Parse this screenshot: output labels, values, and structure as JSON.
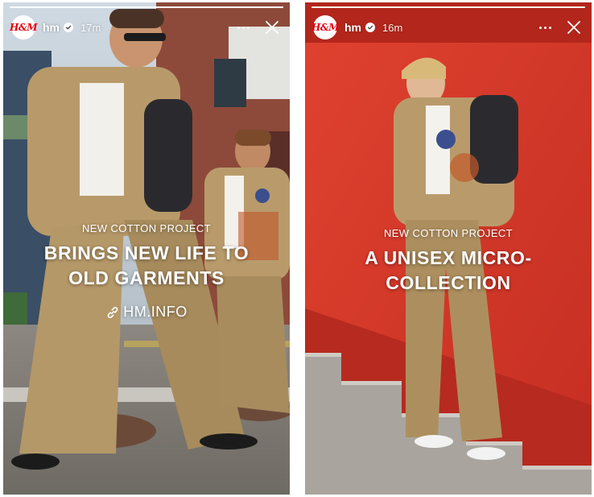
{
  "colors": {
    "brand_red": "#e50010",
    "wall_red": "#d9362a",
    "jacket_tan": "#b89a6a"
  },
  "stories": [
    {
      "account": {
        "username": "hm",
        "avatar_text": "H&M",
        "verified": true
      },
      "time": "17m",
      "progress": 1.0,
      "kicker": "NEW COTTON PROJECT",
      "headline": "BRINGS NEW LIFE TO OLD GARMENTS",
      "link": {
        "label": "HM.INFO",
        "icon": "link-icon"
      },
      "icons": {
        "more": "more-icon",
        "close": "close-icon",
        "verified": "verified-icon"
      }
    },
    {
      "account": {
        "username": "hm",
        "avatar_text": "H&M",
        "verified": true
      },
      "time": "16m",
      "progress": 1.0,
      "kicker": "NEW COTTON PROJECT",
      "headline": "A UNISEX MICRO-COLLECTION",
      "icons": {
        "more": "more-icon",
        "close": "close-icon",
        "verified": "verified-icon"
      }
    }
  ]
}
